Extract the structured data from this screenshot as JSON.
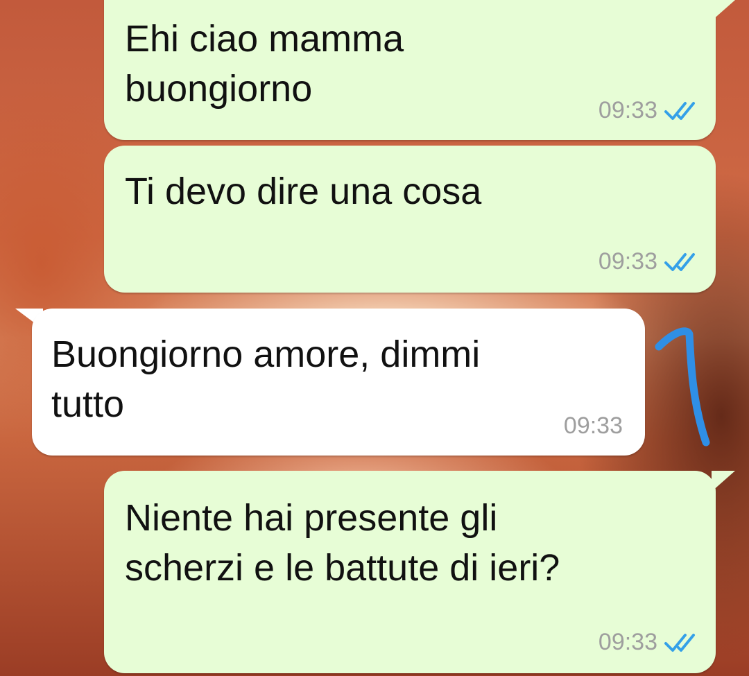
{
  "colors": {
    "outgoing_bubble": "#e7fdd6",
    "incoming_bubble": "#ffffff",
    "read_ticks": "#34a0e8",
    "timestamp": "#9e9e9e",
    "annotation_stroke": "#2f8fe6"
  },
  "messages": [
    {
      "direction": "outgoing",
      "text": "Ehi ciao mamma\nbuongiorno",
      "time": "09:33",
      "status_icon": "double-check-read-icon"
    },
    {
      "direction": "outgoing",
      "text": "Ti devo dire una cosa",
      "time": "09:33",
      "status_icon": "double-check-read-icon"
    },
    {
      "direction": "incoming",
      "text": "Buongiorno amore, dimmi\ntutto",
      "time": "09:33"
    },
    {
      "direction": "outgoing",
      "text": "Niente hai presente gli\nscherzi e le battute di ieri?",
      "time": "09:33",
      "status_icon": "double-check-read-icon"
    }
  ],
  "annotation": {
    "type": "hand-drawn-arrow",
    "color": "#2f8fe6"
  }
}
